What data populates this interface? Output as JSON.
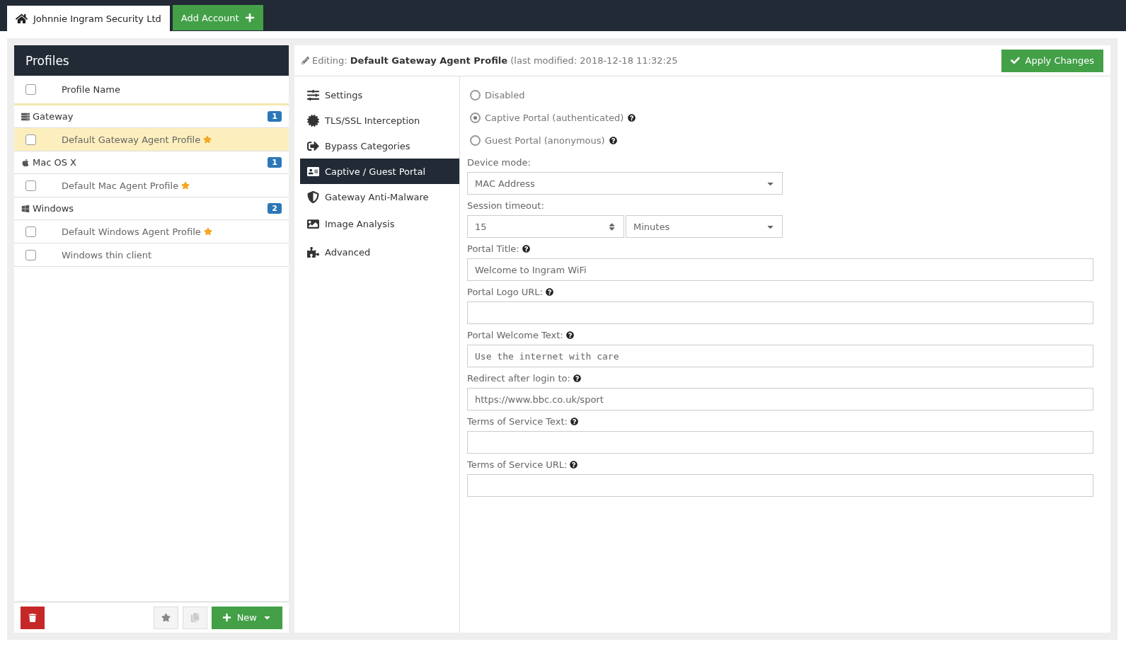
{
  "tabs": [
    {
      "label": "Johnnie Ingram Security Ltd",
      "selected": true
    },
    {
      "label": "Add Account",
      "selected": false
    }
  ],
  "profiles": {
    "title": "Profiles",
    "header": {
      "label": "Profile Name",
      "checked": false
    },
    "groups": [
      {
        "name": "Gateway",
        "count": "1",
        "items": [
          {
            "name": "Default Gateway Agent Profile",
            "starred": true,
            "checked": false,
            "selected": true
          }
        ]
      },
      {
        "name": "Mac OS X",
        "count": "1",
        "items": [
          {
            "name": "Default Mac Agent Profile",
            "starred": true,
            "checked": false,
            "selected": false
          }
        ]
      },
      {
        "name": "Windows",
        "count": "2",
        "items": [
          {
            "name": "Default Windows Agent Profile",
            "starred": true,
            "checked": false,
            "selected": false
          },
          {
            "name": "Windows thin client",
            "starred": false,
            "checked": false,
            "selected": false
          }
        ]
      }
    ],
    "new_button": "New"
  },
  "editor": {
    "prefix": "Editing:",
    "profile": "Default Gateway Agent Profile",
    "modified": "(last modified: 2018-12-18 11:32:25",
    "apply_button": "Apply Changes",
    "nav": [
      {
        "label": "Settings",
        "selected": false
      },
      {
        "label": "TLS/SSL Interception",
        "selected": false
      },
      {
        "label": "Bypass Categories",
        "selected": false
      },
      {
        "label": "Captive / Guest Portal",
        "selected": true
      },
      {
        "label": "Gateway Anti-Malware",
        "selected": false
      },
      {
        "label": "Image Analysis",
        "selected": false
      },
      {
        "label": "Advanced",
        "selected": false
      }
    ],
    "fields": [
      {
        "kind": "radio",
        "options": [
          {
            "label": "Disabled",
            "selected": false,
            "help": false
          },
          {
            "label": "Captive Portal (authenticated)",
            "selected": true,
            "help": true
          },
          {
            "label": "Guest Portal (anonymous)",
            "selected": false,
            "help": true
          }
        ]
      },
      {
        "kind": "select",
        "label": "Device mode:",
        "help": false,
        "value": "MAC Address"
      },
      {
        "kind": "number",
        "label": "Session timeout:",
        "help": false,
        "value": "15",
        "unit": "Minutes"
      },
      {
        "kind": "text",
        "label": "Portal Title:",
        "help": true,
        "value": "Welcome to Ingram WiFi"
      },
      {
        "kind": "text",
        "label": "Portal Logo URL:",
        "help": true
      },
      {
        "kind": "mono",
        "label": "Portal Welcome Text:",
        "help": true,
        "value": "Use the internet with care"
      },
      {
        "kind": "text",
        "label": "Redirect after login to:",
        "help": true,
        "value": "https://www.bbc.co.uk/sport"
      },
      {
        "kind": "text",
        "label": "Terms of Service Text:",
        "help": true
      },
      {
        "kind": "text",
        "label": "Terms of Service URL:",
        "help": true
      }
    ]
  }
}
